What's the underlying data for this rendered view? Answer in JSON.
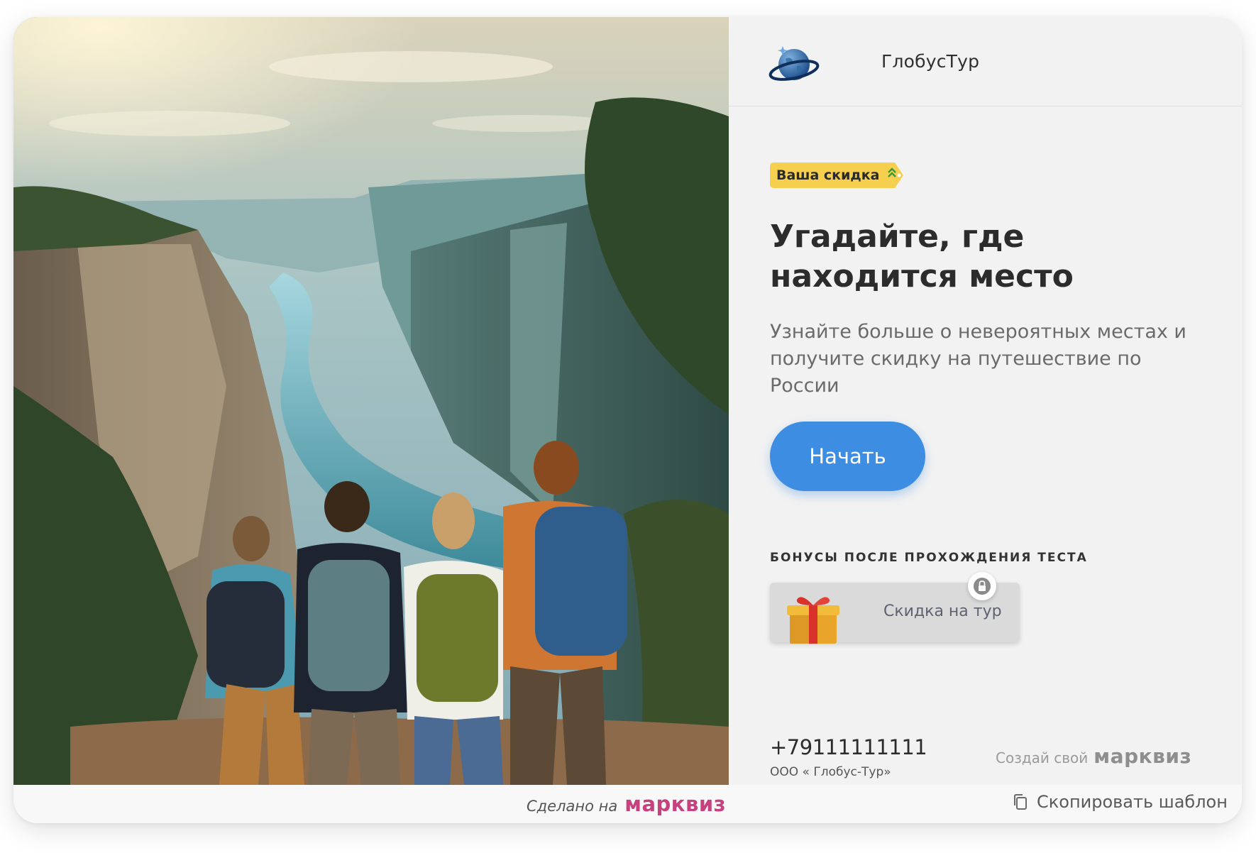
{
  "header": {
    "brand_name": "ГлобусТур",
    "logo_icon": "globe-icon"
  },
  "badge": {
    "label": "Ваша скидка",
    "color": "#f6cf4f"
  },
  "hero": {
    "title": "Угадайте, где находится место",
    "subtitle": "Узнайте больше о невероятных местах и получите скидку на путешествие по России",
    "start_button": "Начать",
    "accent_color": "#3d8de3"
  },
  "bonuses": {
    "heading": "БОНУСЫ ПОСЛЕ ПРОХОЖДЕНИЯ ТЕСТА",
    "items": [
      {
        "label": "Скидка на тур",
        "icon": "gift-icon",
        "locked": true
      }
    ]
  },
  "contacts": {
    "phone": "+79111111111",
    "company": "ООО « Глобус-Тур»"
  },
  "create_own": {
    "text": "Создай свой",
    "brand": "марквиз"
  },
  "footer": {
    "made_on_text": "Сделано на",
    "made_on_brand": "марквиз",
    "brand_color": "#c6417e",
    "copy_template": "Скопировать шаблон"
  }
}
